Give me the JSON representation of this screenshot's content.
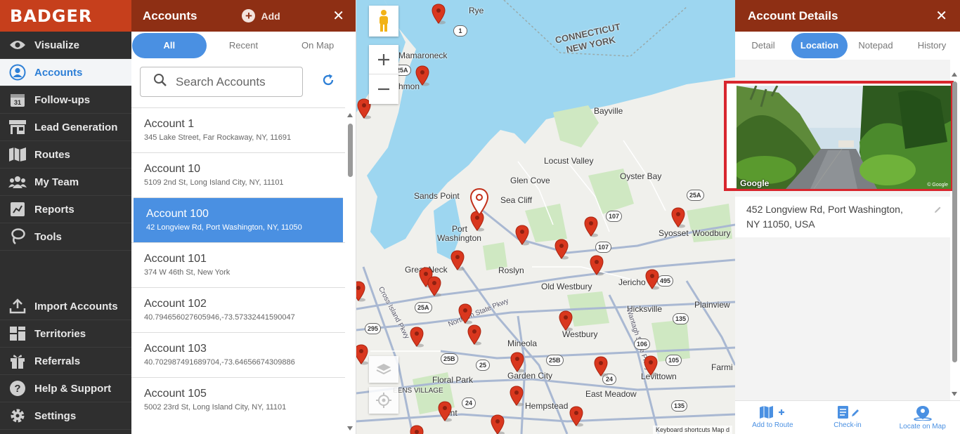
{
  "nav": {
    "logo": "BADGER",
    "items": [
      {
        "label": "Visualize"
      },
      {
        "label": "Accounts"
      },
      {
        "label": "Follow-ups"
      },
      {
        "label": "Lead Generation"
      },
      {
        "label": "Routes"
      },
      {
        "label": "My Team"
      },
      {
        "label": "Reports"
      },
      {
        "label": "Tools"
      }
    ],
    "bottom_items": [
      {
        "label": "Import Accounts"
      },
      {
        "label": "Territories"
      },
      {
        "label": "Referrals"
      },
      {
        "label": "Help & Support"
      },
      {
        "label": "Settings"
      }
    ],
    "calendar_day": "31"
  },
  "accounts": {
    "title": "Accounts",
    "add_label": "Add",
    "close": "✕",
    "tabs": [
      {
        "label": "All"
      },
      {
        "label": "Recent"
      },
      {
        "label": "On Map"
      }
    ],
    "search_placeholder": "Search Accounts",
    "rows": [
      {
        "name": "Account 1",
        "address": "345 Lake Street, Far Rockaway, NY, 11691"
      },
      {
        "name": "Account 10",
        "address": "5109 2nd St, Long Island City, NY, 11101"
      },
      {
        "name": "Account 100",
        "address": "42 Longview Rd, Port Washington, NY, 11050"
      },
      {
        "name": "Account 101",
        "address": "374 W 46th St, New York"
      },
      {
        "name": "Account 102",
        "address": "40.794656027605946,-73.57332441590047"
      },
      {
        "name": "Account 103",
        "address": "40.702987491689704,-73.64656674309886"
      },
      {
        "name": "Account 105",
        "address": "5002 23rd St, Long Island City, NY, 11101"
      }
    ]
  },
  "map": {
    "labels": {
      "rye": "Rye",
      "ct_ny_1": "CONNECTICUT",
      "ct_ny_2": "NEW YORK",
      "mamaroneck": "Mamaroneck",
      "hmon": "hmon",
      "bayville": "Bayville",
      "locust_valley": "Locust Valley",
      "glen_cove": "Glen Cove",
      "oyster_bay": "Oyster Bay",
      "sands_point": "Sands Point",
      "sea_cliff": "Sea Cliff",
      "port_washington_1": "Port",
      "port_washington_2": "Washington",
      "syosset": "Syosset",
      "woodbury": "Woodbury",
      "great_neck": "Great Neck",
      "roslyn": "Roslyn",
      "old_westbury": "Old Westbury",
      "jericho": "Jericho",
      "hicksville": "Hicksville",
      "plainview": "Plainview",
      "cross_island": "Cross Island Pkwy",
      "northern_state": "Northern State Pkwy",
      "wantagh": "Wantagh State Pkwy",
      "westbury": "Westbury",
      "mineola": "Mineola",
      "floral_park": "Floral Park",
      "garden_city": "Garden City",
      "levittown": "Levittown",
      "farmi": "Farmi",
      "east_meadow": "East Meadow",
      "hempstead": "Hempstead",
      "queens_village": "EENS VILLAGE",
      "ont": "ont"
    },
    "shields": [
      "1",
      "25A",
      "25A",
      "107",
      "107",
      "25A",
      "295",
      "495",
      "25B",
      "25",
      "135",
      "106",
      "24",
      "105",
      "135",
      "24",
      "25B"
    ],
    "attribution": "Keyboard shortcuts   Map d"
  },
  "details": {
    "title": "Account Details",
    "close": "✕",
    "tabs": [
      {
        "label": "Detail"
      },
      {
        "label": "Location"
      },
      {
        "label": "Notepad"
      },
      {
        "label": "History"
      }
    ],
    "photo_credit": "Google",
    "photo_credit_small": "© Google",
    "address_line1": "452 Longview Rd, Port Washington,",
    "address_line2": "NY 11050, USA",
    "actions": [
      {
        "label": "Add to Route"
      },
      {
        "label": "Check-in"
      },
      {
        "label": "Locate on Map"
      }
    ]
  },
  "colors": {
    "brand_red": "#c63f1c",
    "header_dark": "#8e2f14",
    "accent_blue": "#4a90e2",
    "pin_red": "#d9371e",
    "water": "#9dd6f0",
    "highlight_red": "#d8262e"
  }
}
